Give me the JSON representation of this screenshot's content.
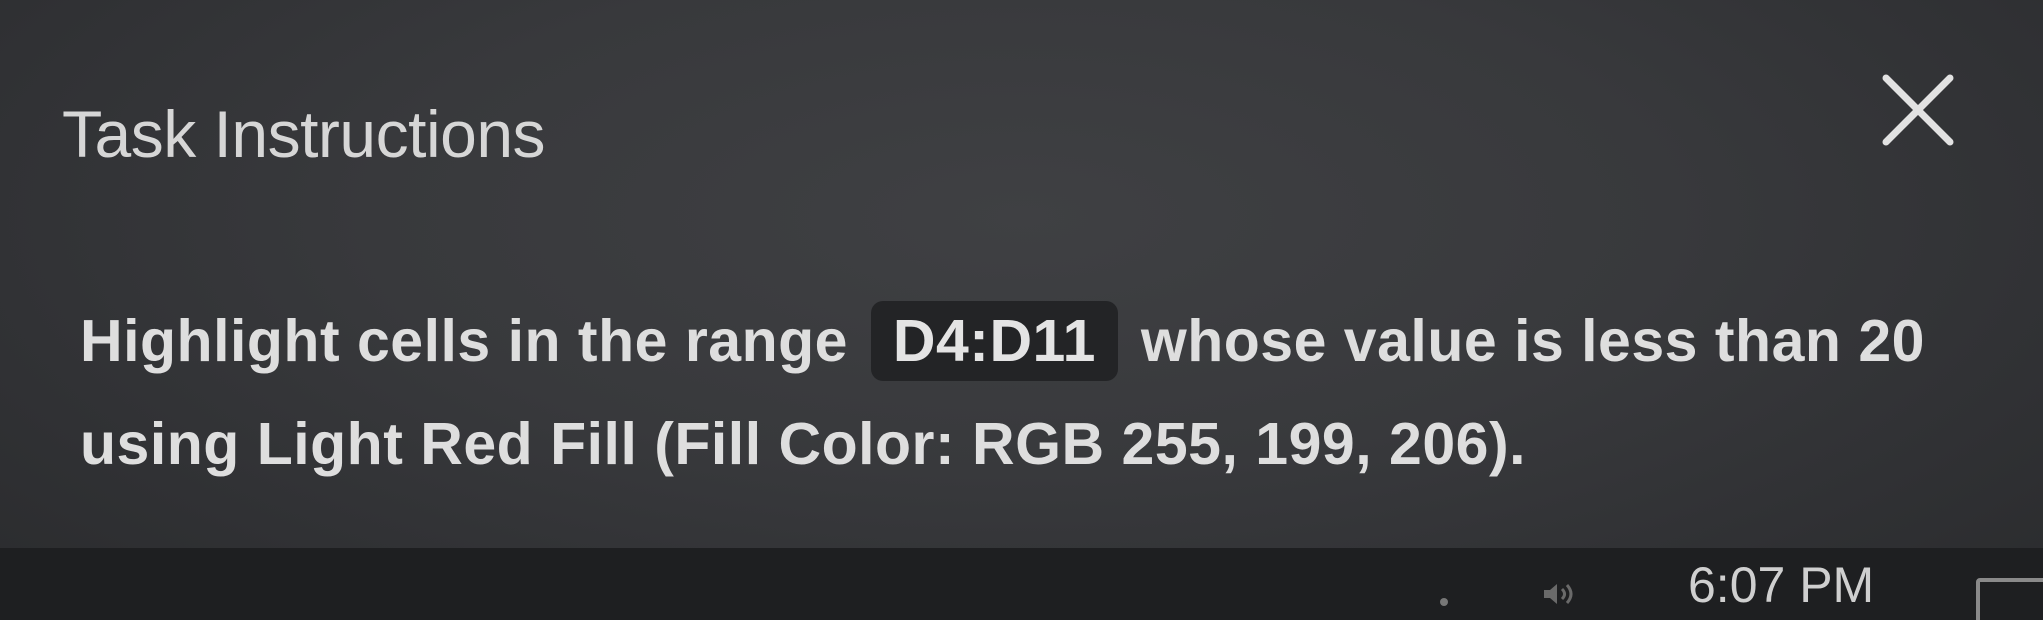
{
  "panel": {
    "title": "Task Instructions",
    "close_icon": "close-x-icon",
    "instruction_before": "Highlight cells in the range ",
    "range": "D4:D11",
    "instruction_after": " whose value is less than 20 using Light Red Fill (Fill Color: RGB 255, 199, 206)."
  },
  "taskbar": {
    "tray_icons": [
      "tray-icon",
      "speaker-icon"
    ],
    "clock": "6:07 PM"
  },
  "colors": {
    "panel_background": "#38393c",
    "taskbar_background": "#1e1f21",
    "range_chip": "#232426",
    "text": "#dedede"
  }
}
